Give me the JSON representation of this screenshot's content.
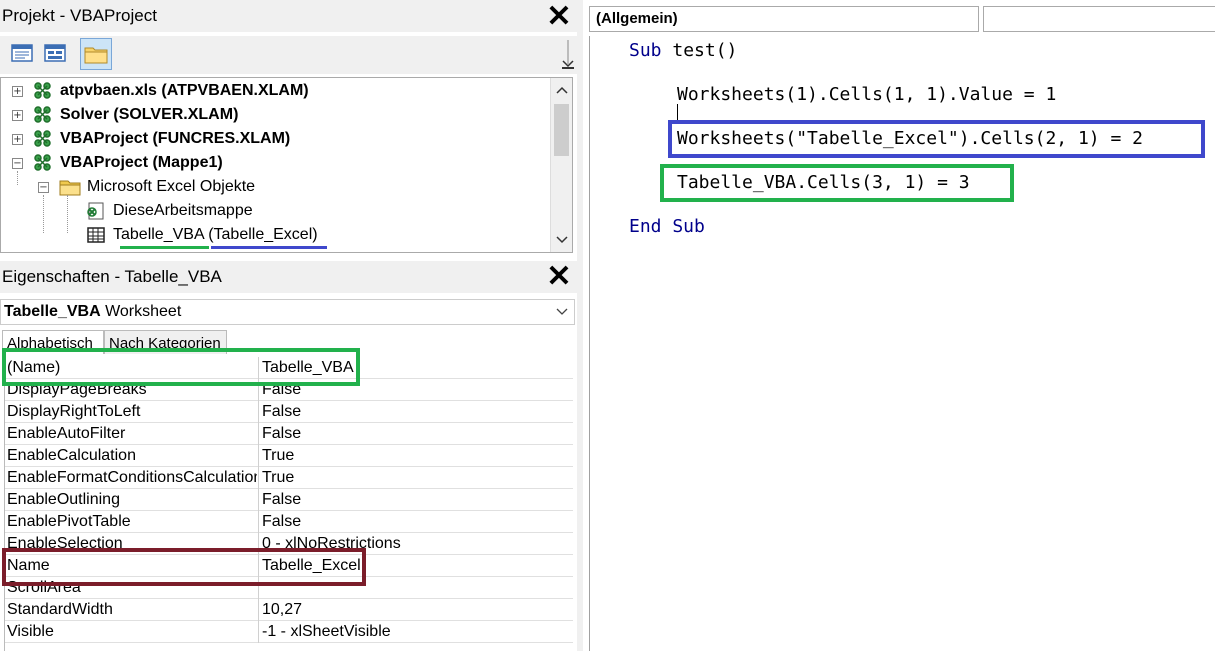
{
  "project_pane": {
    "title": "Projekt - VBAProject",
    "close_glyph": "✕",
    "toolbar": [
      "view-code-icon",
      "view-object-icon",
      "toggle-folders-icon"
    ],
    "tree": [
      {
        "label": "atpvbaen.xls (ATPVBAEN.XLAM)",
        "bold": true,
        "expander": "+",
        "icon": "vba-project-icon"
      },
      {
        "label": "Solver (SOLVER.XLAM)",
        "bold": true,
        "expander": "+",
        "icon": "vba-project-icon"
      },
      {
        "label": "VBAProject (FUNCRES.XLAM)",
        "bold": true,
        "expander": "+",
        "icon": "vba-project-icon"
      },
      {
        "label": "VBAProject (Mappe1)",
        "bold": true,
        "expander": "−",
        "icon": "vba-project-icon"
      },
      {
        "label": "Microsoft Excel Objekte",
        "bold": false,
        "expander": "−",
        "icon": "folder-icon"
      },
      {
        "label": "DieseArbeitsmappe",
        "bold": false,
        "icon": "workbook-icon"
      },
      {
        "label": "Tabelle_VBA",
        "label_suffix": "(Tabelle_Excel)",
        "bold": false,
        "icon": "worksheet-icon"
      }
    ]
  },
  "properties_pane": {
    "title": "Eigenschaften - Tabelle_VBA",
    "close_glyph": "✕",
    "object_name": "Tabelle_VBA",
    "object_type": "Worksheet",
    "tabs": [
      "Alphabetisch",
      "Nach Kategorien"
    ],
    "rows": [
      {
        "name": "(Name)",
        "value": "Tabelle_VBA"
      },
      {
        "name": "DisplayPageBreaks",
        "value": "False"
      },
      {
        "name": "DisplayRightToLeft",
        "value": "False"
      },
      {
        "name": "EnableAutoFilter",
        "value": "False"
      },
      {
        "name": "EnableCalculation",
        "value": "True"
      },
      {
        "name": "EnableFormatConditionsCalculation",
        "value": "True"
      },
      {
        "name": "EnableOutlining",
        "value": "False"
      },
      {
        "name": "EnablePivotTable",
        "value": "False"
      },
      {
        "name": "EnableSelection",
        "value": "0 - xlNoRestrictions"
      },
      {
        "name": "Name",
        "value": "Tabelle_Excel"
      },
      {
        "name": "ScrollArea",
        "value": ""
      },
      {
        "name": "StandardWidth",
        "value": "10,27"
      },
      {
        "name": "Visible",
        "value": "-1 - xlSheetVisible"
      }
    ]
  },
  "code_window": {
    "object_combo": "(Allgemein)",
    "lines": {
      "sub_kw": "Sub",
      "sub_name": "test()",
      "line1": "Worksheets(1).Cells(1, 1).Value = 1",
      "line2": "Worksheets(\"Tabelle_Excel\").Cells(2, 1) = 2",
      "line3": "Tabelle_VBA.Cells(3, 1) = 3",
      "end_sub": "End Sub"
    }
  },
  "colors": {
    "green_highlight": "#22b14c",
    "blue_highlight": "#3f48cc",
    "darkred_highlight": "#7b1d2a",
    "keyword": "#00008b"
  }
}
